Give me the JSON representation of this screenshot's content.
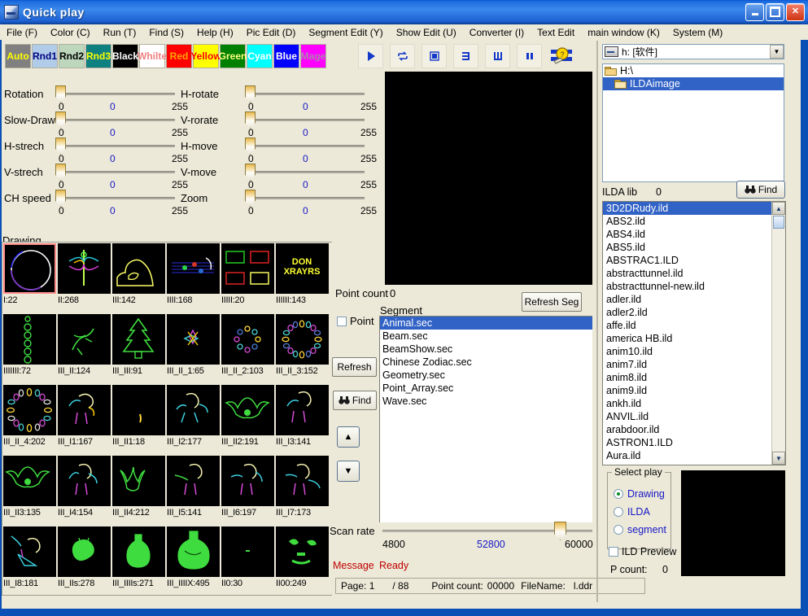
{
  "window": {
    "title": "Quick play",
    "minimize_label": "_",
    "maximize_label": "□",
    "close_label": "✕"
  },
  "menu": {
    "items": [
      {
        "label": "File (F)"
      },
      {
        "label": "Color (C)"
      },
      {
        "label": "Run (T)"
      },
      {
        "label": "Find (S)"
      },
      {
        "label": "Help (H)"
      },
      {
        "label": "Pic Edit (D)"
      },
      {
        "label": "Segment Edit (Y)"
      },
      {
        "label": "Show Edit (U)"
      },
      {
        "label": "Converter (I)"
      },
      {
        "label": "Text Edit"
      },
      {
        "label": "main window (K)"
      },
      {
        "label": "System (M)"
      }
    ]
  },
  "color_buttons": [
    {
      "label": "Auto",
      "bg": "#808080",
      "fg": "#ffff00"
    },
    {
      "label": "Rnd1",
      "bg": "#b0cce8",
      "fg": "#000080"
    },
    {
      "label": "Rnd2",
      "bg": "#bcd7bc",
      "fg": "#000000"
    },
    {
      "label": "Rnd3",
      "bg": "#0f8080",
      "fg": "#ffff00"
    },
    {
      "label": "Black",
      "bg": "#000000",
      "fg": "#ffffff"
    },
    {
      "label": "Whilte",
      "bg": "#ffffff",
      "fg": "#f08080"
    },
    {
      "label": "Red",
      "bg": "#ff0000",
      "fg": "#ffa500"
    },
    {
      "label": "Yellow",
      "bg": "#ffff00",
      "fg": "#ff0000"
    },
    {
      "label": "Green",
      "bg": "#008000",
      "fg": "#ffff80"
    },
    {
      "label": "Cyan",
      "bg": "#00ffff",
      "fg": "#ffffff"
    },
    {
      "label": "Blue",
      "bg": "#0000ff",
      "fg": "#ffffff"
    },
    {
      "label": "Mage",
      "bg": "#ff00ff",
      "fg": "#b080b0"
    }
  ],
  "toolbar": {
    "buttons": [
      {
        "name": "play-icon"
      },
      {
        "name": "loop-icon"
      },
      {
        "name": "stop-icon"
      },
      {
        "name": "step-icon"
      },
      {
        "name": "grid-icon"
      },
      {
        "name": "pause-icon"
      },
      {
        "name": "settings-icon"
      }
    ]
  },
  "sliders": {
    "left": [
      {
        "label": "Rotation",
        "min": "0",
        "value": "0",
        "max": "255"
      },
      {
        "label": "Slow-Draw",
        "min": "0",
        "value": "0",
        "max": "255"
      },
      {
        "label": "H-strech",
        "min": "0",
        "value": "0",
        "max": "255"
      },
      {
        "label": "V-strech",
        "min": "0",
        "value": "0",
        "max": "255"
      },
      {
        "label": "CH speed",
        "min": "0",
        "value": "0",
        "max": "255"
      }
    ],
    "right": [
      {
        "label": "H-rotate",
        "min": "0",
        "value": "0",
        "max": "255"
      },
      {
        "label": "V-rorate",
        "min": "0",
        "value": "0",
        "max": "255"
      },
      {
        "label": "H-move",
        "min": "0",
        "value": "0",
        "max": "255"
      },
      {
        "label": "V-move",
        "min": "0",
        "value": "0",
        "max": "255"
      },
      {
        "label": "Zoom",
        "min": "0",
        "value": "0",
        "max": "255"
      }
    ],
    "drawing_label": "Drawing"
  },
  "thumbnails": {
    "rows": [
      [
        {
          "label": "I:22",
          "selected": true,
          "art": "circle"
        },
        {
          "label": "II:268",
          "selected": false,
          "art": "dragonfly"
        },
        {
          "label": "III:142",
          "selected": false,
          "art": "bear"
        },
        {
          "label": "IIII:168",
          "selected": false,
          "art": "notes"
        },
        {
          "label": "IIIII:20",
          "selected": false,
          "art": "rects"
        },
        {
          "label": "IIIIII:143",
          "selected": false,
          "art": "text"
        }
      ],
      [
        {
          "label": "IIIIIII:72",
          "selected": false,
          "art": "beads"
        },
        {
          "label": "III_II:124",
          "selected": false,
          "art": "figure-green"
        },
        {
          "label": "III_III:91",
          "selected": false,
          "art": "tree"
        },
        {
          "label": "III_II_1:65",
          "selected": false,
          "art": "flower"
        },
        {
          "label": "III_II_2:103",
          "selected": false,
          "art": "ring-small"
        },
        {
          "label": "III_II_3:152",
          "selected": false,
          "art": "ring-large"
        }
      ],
      [
        {
          "label": "III_II_4:202",
          "selected": false,
          "art": "ring-wide"
        },
        {
          "label": "III_I1:167",
          "selected": false,
          "art": "person-a"
        },
        {
          "label": "III_II1:18",
          "selected": false,
          "art": "tiny"
        },
        {
          "label": "III_I2:177",
          "selected": false,
          "art": "person-b"
        },
        {
          "label": "III_II2:191",
          "selected": false,
          "art": "bat"
        },
        {
          "label": "III_I3:141",
          "selected": false,
          "art": "person-c"
        }
      ],
      [
        {
          "label": "III_II3:135",
          "selected": false,
          "art": "bat2"
        },
        {
          "label": "III_I4:154",
          "selected": false,
          "art": "person-d"
        },
        {
          "label": "III_II4:212",
          "selected": false,
          "art": "bats2"
        },
        {
          "label": "III_I5:141",
          "selected": false,
          "art": "person-e"
        },
        {
          "label": "III_I6:197",
          "selected": false,
          "art": "person-f"
        },
        {
          "label": "III_I7:173",
          "selected": false,
          "art": "person-g"
        }
      ],
      [
        {
          "label": "III_I8:181",
          "selected": false,
          "art": "person-h"
        },
        {
          "label": "III_IIs:278",
          "selected": false,
          "art": "blob"
        },
        {
          "label": "III_IIIIs:271",
          "selected": false,
          "art": "vase"
        },
        {
          "label": "III_IIIIX:495",
          "selected": false,
          "art": "vase2"
        },
        {
          "label": "II0:30",
          "selected": false,
          "art": "dot"
        },
        {
          "label": "II00:249",
          "selected": false,
          "art": "face"
        }
      ]
    ]
  },
  "center": {
    "point_count_label": "Point count",
    "point_count_value": "0",
    "segment_label": "Segment",
    "refresh_seg_label": "Refresh Seg",
    "point_checkbox_label": "Point",
    "refresh_label": "Refresh",
    "find_label": "Find",
    "up_label": "▲",
    "down_label": "▼",
    "segments": [
      {
        "label": "Animal.sec",
        "selected": true
      },
      {
        "label": "Beam.sec",
        "selected": false
      },
      {
        "label": "BeamShow.sec",
        "selected": false
      },
      {
        "label": "Chinese Zodiac.sec",
        "selected": false
      },
      {
        "label": "Geometry.sec",
        "selected": false
      },
      {
        "label": "Point_Array.sec",
        "selected": false
      },
      {
        "label": "Wave.sec",
        "selected": false
      }
    ],
    "scan_rate_label": "Scan rate",
    "scan_min": "4800",
    "scan_value": "52800",
    "scan_max": "60000",
    "message_label": "Message",
    "message_value": "Ready"
  },
  "statusbar": {
    "page_label": "Page: 1",
    "page_total": "/ 88",
    "point_count_label": "Point count:",
    "point_count_value": "00000",
    "filename_label": "FileName:",
    "filename_value": "l.ddr"
  },
  "right": {
    "drive_value": "h: [软件]",
    "dirs": [
      {
        "label": "H:\\",
        "selected": false,
        "open": false
      },
      {
        "label": "ILDAimage",
        "selected": true,
        "open": true
      }
    ],
    "ilda_lib_label": "ILDA lib",
    "ilda_lib_value": "0",
    "find_label": "Find",
    "files": [
      {
        "label": "3D2DRudy.ild",
        "selected": true
      },
      {
        "label": "ABS2.ild",
        "selected": false
      },
      {
        "label": "ABS4.ild",
        "selected": false
      },
      {
        "label": "ABS5.ild",
        "selected": false
      },
      {
        "label": "ABSTRAC1.ILD",
        "selected": false
      },
      {
        "label": "abstracttunnel.ild",
        "selected": false
      },
      {
        "label": "abstracttunnel-new.ild",
        "selected": false
      },
      {
        "label": "adler.ild",
        "selected": false
      },
      {
        "label": "adler2.ild",
        "selected": false
      },
      {
        "label": "affe.ild",
        "selected": false
      },
      {
        "label": "america HB.ild",
        "selected": false
      },
      {
        "label": "anim10.ild",
        "selected": false
      },
      {
        "label": "anim7.ild",
        "selected": false
      },
      {
        "label": "anim8.ild",
        "selected": false
      },
      {
        "label": "anim9.ild",
        "selected": false
      },
      {
        "label": "ankh.ild",
        "selected": false
      },
      {
        "label": "ANVIL.ild",
        "selected": false
      },
      {
        "label": "arabdoor.ild",
        "selected": false
      },
      {
        "label": "ASTRON1.ILD",
        "selected": false
      },
      {
        "label": "Aura.ild",
        "selected": false
      }
    ],
    "select_play": {
      "title": "Select play",
      "options": [
        {
          "label": "Drawing",
          "selected": true
        },
        {
          "label": "ILDA",
          "selected": false
        },
        {
          "label": "segment",
          "selected": false
        }
      ]
    },
    "ild_preview_label": "ILD Preview",
    "p_count_label": "P count:",
    "p_count_value": "0"
  }
}
